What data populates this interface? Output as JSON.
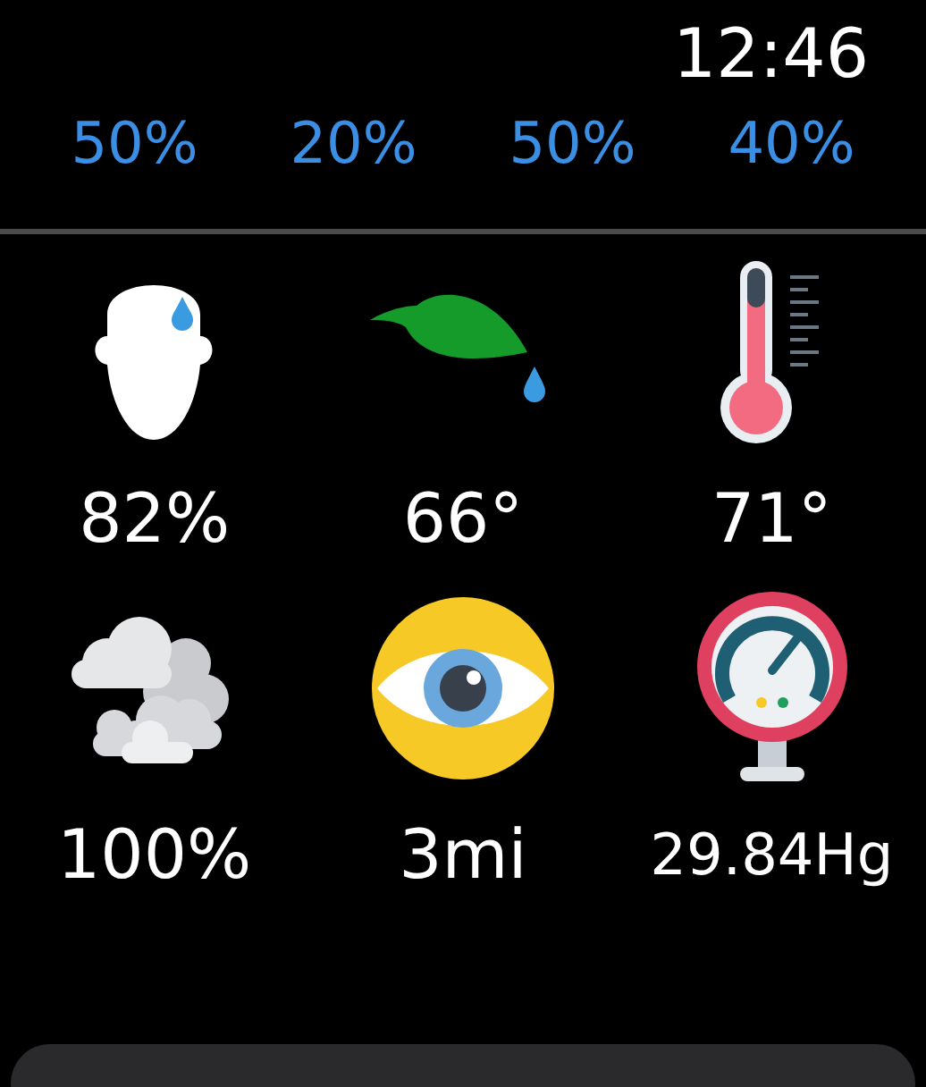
{
  "status_bar": {
    "time": "12:46"
  },
  "forecast_row": [
    "50%",
    "20%",
    "50%",
    "40%"
  ],
  "tiles": [
    {
      "kind": "humidity",
      "value": "82%"
    },
    {
      "kind": "dew_point",
      "value": "66°"
    },
    {
      "kind": "temperature",
      "value": "71°"
    },
    {
      "kind": "cloud_cover",
      "value": "100%"
    },
    {
      "kind": "visibility",
      "value": "3mi"
    },
    {
      "kind": "pressure",
      "value": "29.84Hg"
    }
  ]
}
